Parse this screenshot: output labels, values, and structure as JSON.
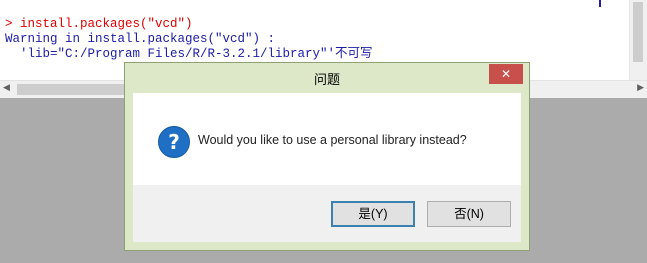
{
  "console": {
    "line1": "> install.packages(\"vcd\")",
    "line2": "Warning in install.packages(\"vcd\") :",
    "line3": "  'lib=\"C:/Program Files/R/R-3.2.1/library\"'不可写"
  },
  "dialog": {
    "title": "问题",
    "close_label": "✕",
    "message": "Would you like to use a personal library instead?",
    "icon": "question-icon",
    "yes_label": "是(Y)",
    "no_label": "否(N)"
  },
  "colors": {
    "command": "#e00000",
    "output": "#1c1ca8",
    "dialog_frame": "#dce8c8",
    "close_button": "#c7504b",
    "question_icon": "#1f6fc4"
  }
}
